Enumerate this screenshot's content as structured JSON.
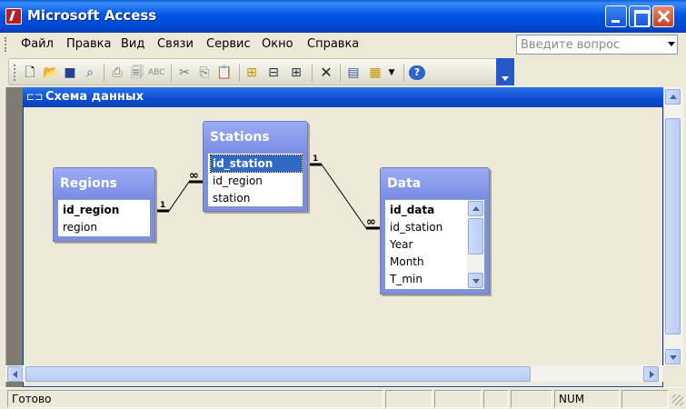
{
  "window": {
    "title": "Microsoft Access"
  },
  "menu": {
    "items": [
      "Файл",
      "Правка",
      "Вид",
      "Связи",
      "Сервис",
      "Окно",
      "Справка"
    ]
  },
  "help": {
    "placeholder": "Введите вопрос"
  },
  "toolbar": {
    "icons": [
      "new-document-icon",
      "open-folder-icon",
      "save-icon",
      "search-file-icon",
      "print-icon",
      "print-preview-icon",
      "spelling-icon",
      "cut-icon",
      "copy-icon",
      "paste-icon",
      "show-table-icon",
      "show-direct-relationships-icon",
      "show-all-relationships-icon",
      "delete-icon",
      "properties-icon",
      "new-object-icon",
      "help-icon"
    ]
  },
  "inner_window": {
    "title": "Схема данных"
  },
  "tables": {
    "regions": {
      "name": "Regions",
      "fields": [
        "id_region",
        "region"
      ],
      "primary_key": "id_region"
    },
    "stations": {
      "name": "Stations",
      "fields": [
        "id_station",
        "id_region",
        "station"
      ],
      "primary_key": "id_station",
      "selected": "id_station"
    },
    "data": {
      "name": "Data",
      "fields": [
        "id_data",
        "id_station",
        "Year",
        "Month",
        "T_min"
      ],
      "primary_key": "id_data"
    }
  },
  "relationships": [
    {
      "from": "Regions.id_region",
      "to": "Stations.id_region",
      "one_label": "1",
      "many_label": "∞"
    },
    {
      "from": "Stations.id_station",
      "to": "Data.id_station",
      "one_label": "1",
      "many_label": "∞"
    }
  ],
  "status": {
    "text": "Готово",
    "num": "NUM"
  },
  "colors": {
    "table_header": "#8e9ef0",
    "title_bar": "#0055e5",
    "selection": "#316ac5"
  }
}
